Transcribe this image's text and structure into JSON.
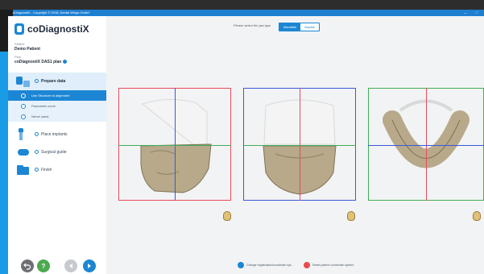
{
  "window": {
    "title": "coDiagnostiX - Copyright © 2018, Dental Wings GmbH",
    "min": "—",
    "max": "□"
  },
  "app": {
    "name": "coDiagnostiX"
  },
  "patient": {
    "label": "Patient",
    "name": "Demo Patient"
  },
  "plan": {
    "label": "Plan",
    "name": "coDiagnostiX DAS1 plan"
  },
  "workflow": {
    "prepare_data": "Prepare data",
    "substeps": [
      "Use Structure to alignment",
      "Panoramic curve",
      "Nerve canal"
    ],
    "place_implants": "Place implants",
    "surgical_guide": "Surgical guide",
    "finish": "Finish"
  },
  "main": {
    "jaw_prompt": "Please select the jaw type",
    "jaw_options": [
      "Mandible",
      "Maxilla"
    ],
    "selected_jaw": "Mandible",
    "actions": [
      {
        "label": "Change registration/coordinate sys.",
        "icon": "coordinate-system-icon",
        "color": "#1c86d4"
      },
      {
        "label": "Reset patient coordinate system",
        "icon": "reset-coordinate-icon",
        "color": "#e84d4d"
      }
    ]
  },
  "colors": {
    "accent": "#1c86d4",
    "sidebar_active": "#dfeefa",
    "view_red": "#e74c5b",
    "view_green": "#3fae58",
    "view_blue": "#3a5ad8",
    "bone": "#b7a98a"
  },
  "footer": {
    "back_icon": "undo-icon",
    "help_label": "?",
    "prev_icon": "prev-arrow-icon",
    "next_icon": "next-arrow-icon"
  }
}
